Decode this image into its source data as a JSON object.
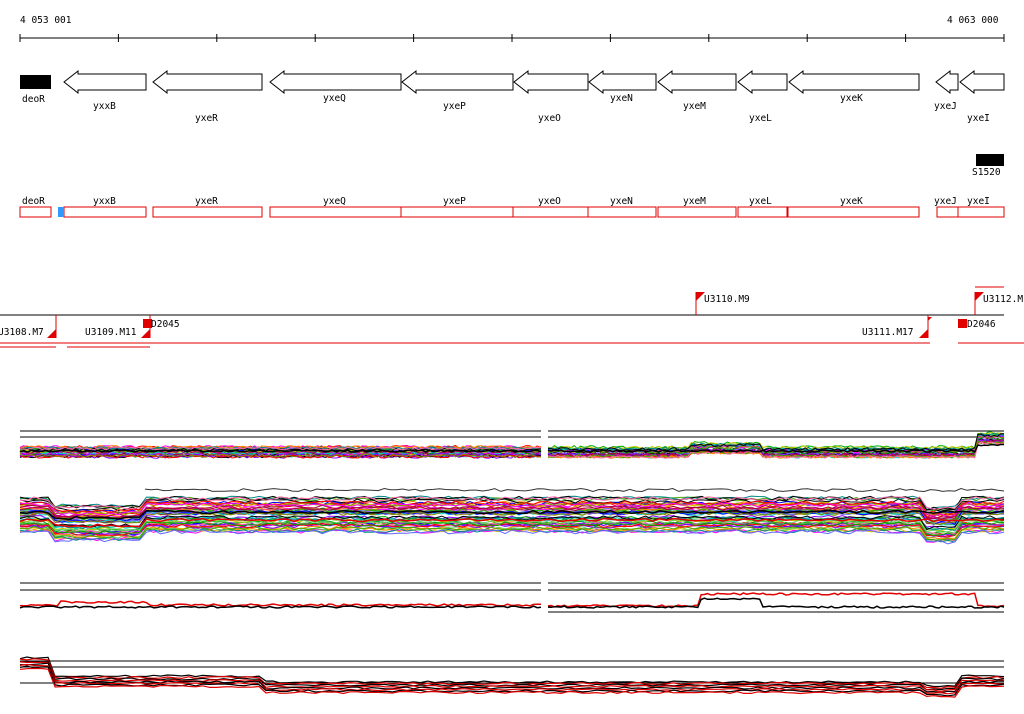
{
  "coordinates": {
    "start": "4 053 001",
    "end": "4 063 000"
  },
  "genes_top": [
    {
      "name": "deoR",
      "strand": "solid"
    },
    {
      "name": "yxxB",
      "strand": "-"
    },
    {
      "name": "yxeR",
      "strand": "-"
    },
    {
      "name": "yxeQ",
      "strand": "-"
    },
    {
      "name": "yxeP",
      "strand": "-"
    },
    {
      "name": "yxeO",
      "strand": "-"
    },
    {
      "name": "yxeN",
      "strand": "-"
    },
    {
      "name": "yxeM",
      "strand": "-"
    },
    {
      "name": "yxeL",
      "strand": "-"
    },
    {
      "name": "yxeK",
      "strand": "-"
    },
    {
      "name": "yxeJ",
      "strand": "-"
    },
    {
      "name": "yxeI",
      "strand": "-"
    }
  ],
  "feature_S": "S1520",
  "genes_red": [
    "deoR",
    "yxxB",
    "yxeR",
    "yxeQ",
    "yxeP",
    "yxeO",
    "yxeN",
    "yxeM",
    "yxeL",
    "yxeK",
    "yxeJ",
    "yxeI"
  ],
  "upshift_labels": {
    "u3108": "U3108.M7",
    "u3109": "U3109.M11",
    "u3110": "U3110.M9",
    "u3111": "U3111.M17",
    "u3112": "U3112.M"
  },
  "downshift_labels": {
    "d2045": "D2045",
    "d2046": "D2046"
  },
  "colors": {
    "gene_box": "#e00000",
    "marker": "#ff0000",
    "blue_marker": "#3399ff",
    "solid_gene": "#000000"
  }
}
